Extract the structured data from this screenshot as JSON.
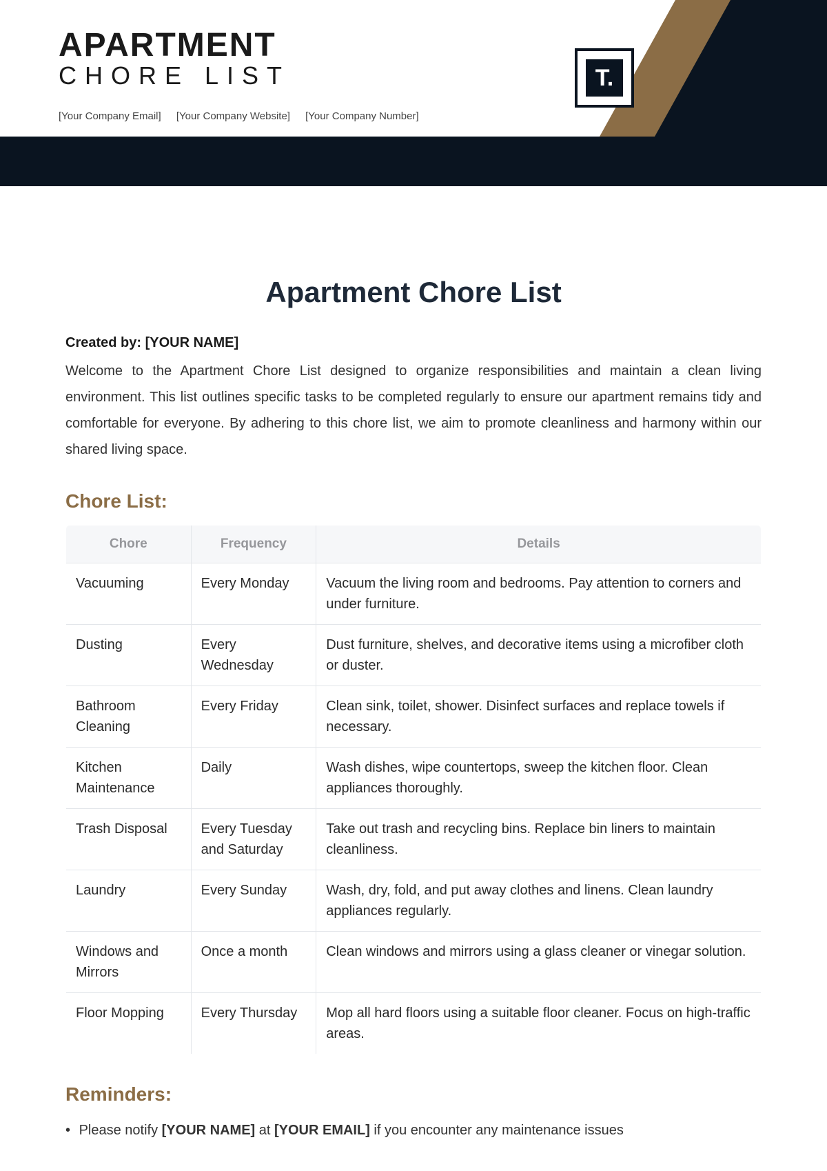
{
  "header": {
    "title_line1": "APARTMENT",
    "title_line2": "CHORE LIST",
    "email": "[Your Company Email]",
    "website": "[Your Company Website]",
    "number": "[Your Company Number]",
    "logo_text": "T."
  },
  "doc": {
    "title": "Apartment Chore List",
    "created_by_label": "Created by: ",
    "created_by_value": "[YOUR NAME]",
    "intro": "Welcome to the Apartment Chore List designed to organize responsibilities and maintain a clean living environment. This list outlines specific tasks to be completed regularly to ensure our apartment remains tidy and comfortable for everyone. By adhering to this chore list, we aim to promote cleanliness and harmony within our shared living space."
  },
  "chore_section": {
    "heading": "Chore List:",
    "columns": {
      "chore": "Chore",
      "frequency": "Frequency",
      "details": "Details"
    },
    "rows": [
      {
        "chore": "Vacuuming",
        "frequency": "Every Monday",
        "details": "Vacuum the living room and bedrooms. Pay attention to corners and under furniture."
      },
      {
        "chore": "Dusting",
        "frequency": "Every Wednesday",
        "details": "Dust furniture, shelves, and decorative items using a microfiber cloth or duster."
      },
      {
        "chore": "Bathroom Cleaning",
        "frequency": "Every Friday",
        "details": "Clean sink, toilet, shower. Disinfect surfaces and replace towels if necessary."
      },
      {
        "chore": "Kitchen Maintenance",
        "frequency": "Daily",
        "details": "Wash dishes, wipe countertops, sweep the kitchen floor. Clean appliances thoroughly."
      },
      {
        "chore": "Trash Disposal",
        "frequency": "Every Tuesday and Saturday",
        "details": "Take out trash and recycling bins. Replace bin liners to maintain cleanliness."
      },
      {
        "chore": "Laundry",
        "frequency": "Every Sunday",
        "details": "Wash, dry, fold, and put away clothes and linens. Clean laundry appliances regularly."
      },
      {
        "chore": "Windows and Mirrors",
        "frequency": "Once a month",
        "details": "Clean windows and mirrors using a glass cleaner or vinegar solution."
      },
      {
        "chore": "Floor Mopping",
        "frequency": "Every Thursday",
        "details": "Mop all hard floors using a suitable floor cleaner. Focus on high-traffic areas."
      }
    ]
  },
  "reminders": {
    "heading": "Reminders:",
    "item1_prefix": "Please notify ",
    "item1_name": "[YOUR NAME]",
    "item1_mid": " at ",
    "item1_email": "[YOUR EMAIL]",
    "item1_suffix": " if you encounter any maintenance issues"
  }
}
